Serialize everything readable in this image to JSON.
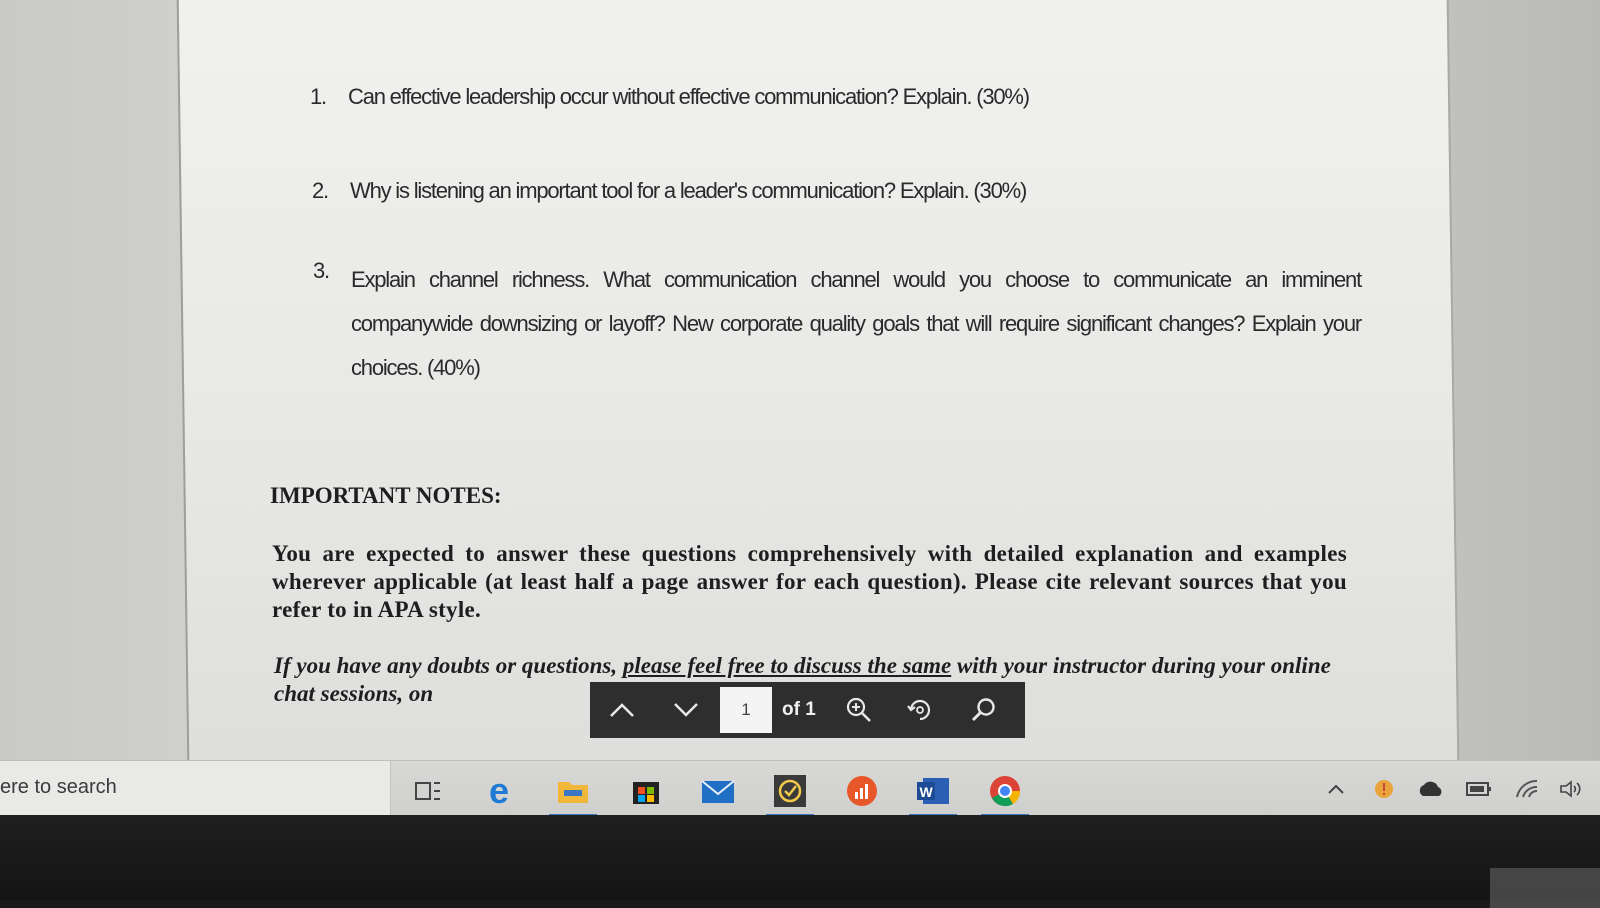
{
  "document": {
    "questions": [
      {
        "num": "1.",
        "text": "Can effective leadership occur without effective communication? Explain. (30%)"
      },
      {
        "num": "2.",
        "text": "Why is listening an important tool for a leader's communication? Explain. (30%)"
      },
      {
        "num": "3.",
        "text": "Explain channel richness. What communication channel would you choose to communicate an imminent companywide downsizing or layoff? New corporate quality goals that will require significant changes? Explain your choices. (40%)"
      }
    ],
    "notes_heading": "IMPORTANT NOTES:",
    "notes_paragraph": "You are expected to answer these questions comprehensively with detailed explanation and examples wherever applicable (at least half a page answer for each question). Please cite relevant sources that you refer to in APA style.",
    "notes_italic_a": "If you have any doubts or questions, ",
    "notes_italic_b": "please feel free to discuss the same",
    "notes_italic_c": " with your instructor during your online chat sessions, on"
  },
  "pdf_toolbar": {
    "page_value": "1",
    "page_total": "of 1",
    "icons": [
      "chevron-up-icon",
      "chevron-down-icon",
      "zoom-in-icon",
      "rotate-icon",
      "search-icon"
    ]
  },
  "taskbar": {
    "search_placeholder": "ere to search",
    "apps": [
      "task-view-icon",
      "edge-icon",
      "file-explorer-icon",
      "store-icon",
      "mail-icon",
      "todo-icon",
      "office-chart-icon",
      "word-icon",
      "chrome-icon"
    ],
    "tray": [
      "chevron-up-icon",
      "warning-icon",
      "onedrive-icon",
      "battery-icon",
      "wifi-icon",
      "volume-icon"
    ]
  },
  "colors": {
    "accent": "#3a78c4",
    "toolbar_bg": "#1e1e1e",
    "page_bg": "#eeeeec"
  }
}
